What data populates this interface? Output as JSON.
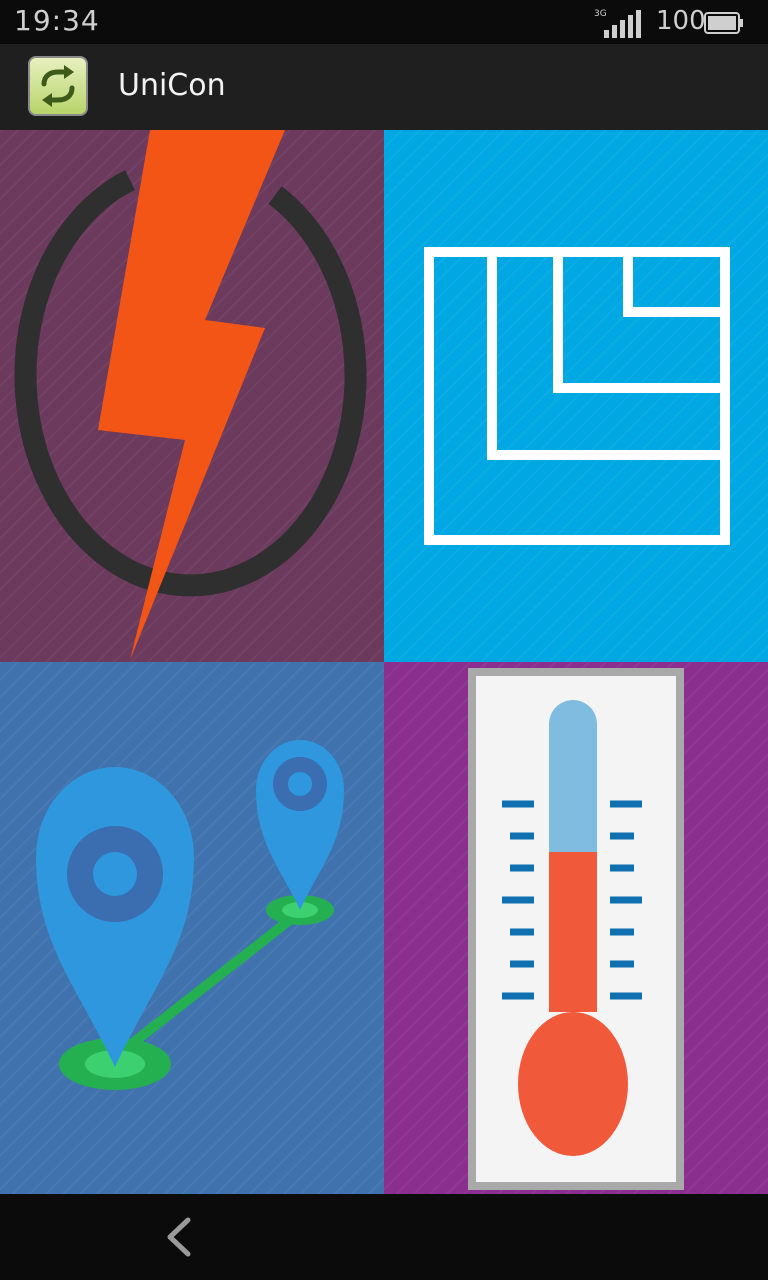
{
  "status_bar": {
    "time": "19:34",
    "network_type": "3G",
    "battery_level": "100"
  },
  "action_bar": {
    "app_name": "UniCon",
    "app_icon": "refresh-arrows-icon"
  },
  "tiles": [
    {
      "name": "power",
      "icon": "lightning-power-icon",
      "color": "#6b3a5d",
      "accent": "#f35517"
    },
    {
      "name": "area",
      "icon": "area-blueprint-icon",
      "color": "#00a8e3",
      "accent": "#ffffff"
    },
    {
      "name": "distance",
      "icon": "location-pins-route-icon",
      "color": "#4073ad",
      "accent": "#2f97de"
    },
    {
      "name": "temperature",
      "icon": "thermometer-icon",
      "color": "#8a2f8e",
      "accent": "#f05a3a"
    }
  ],
  "nav": {
    "back_icon": "back-chevron-icon"
  }
}
